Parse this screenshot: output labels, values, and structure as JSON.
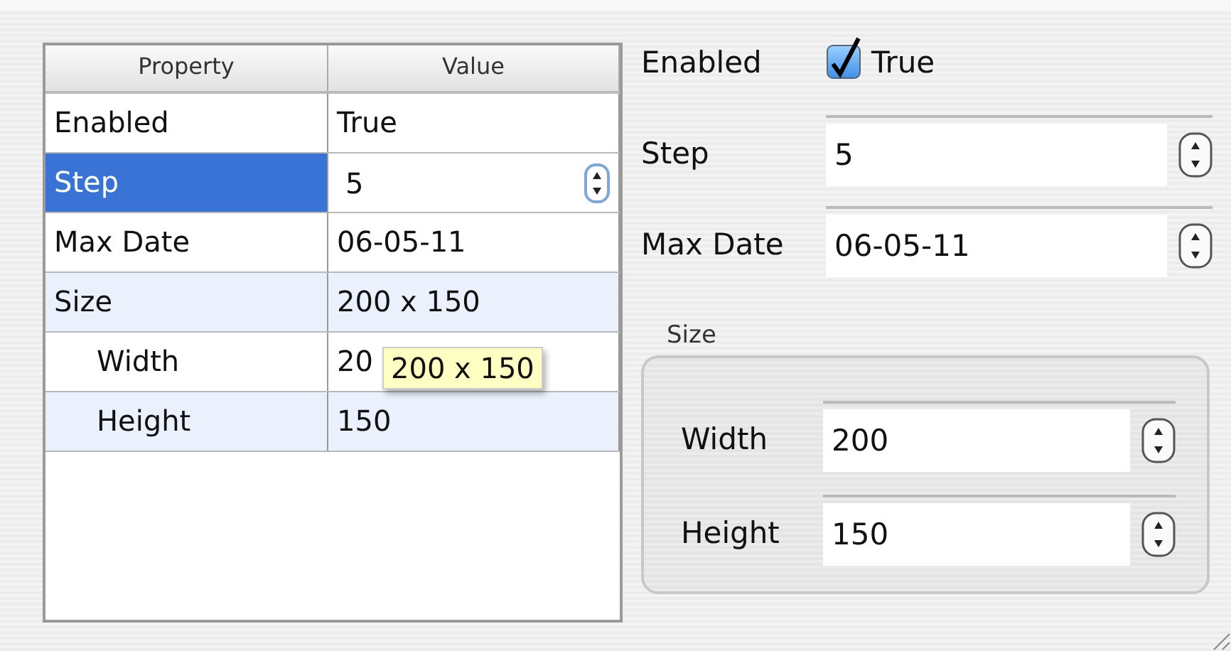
{
  "table": {
    "columns": [
      "Property",
      "Value"
    ],
    "rows": [
      {
        "property": "Enabled",
        "value": "True",
        "selected": false,
        "editing": false
      },
      {
        "property": "Step",
        "value": "5",
        "selected": true,
        "editing": true
      },
      {
        "property": "Max Date",
        "value": "06-05-11",
        "selected": false,
        "editing": false
      },
      {
        "property": "Size",
        "value": "200 x 150",
        "selected": false,
        "editing": false,
        "children": [
          {
            "property": "Width",
            "value": "20",
            "selected": false,
            "editing": false
          },
          {
            "property": "Height",
            "value": "150",
            "selected": false,
            "editing": false
          }
        ]
      }
    ],
    "tooltip": {
      "text": "200 x 150"
    }
  },
  "form": {
    "fields": [
      {
        "kind": "checkbox",
        "label": "Enabled",
        "checked": true,
        "text": "True"
      },
      {
        "kind": "spinner",
        "label": "Step",
        "value": "5"
      },
      {
        "kind": "spinner",
        "label": "Max Date",
        "value": "06-05-11"
      }
    ],
    "group": {
      "title": "Size",
      "fields": [
        {
          "kind": "spinner",
          "label": "Width",
          "value": "200"
        },
        {
          "kind": "spinner",
          "label": "Height",
          "value": "150"
        }
      ]
    }
  }
}
